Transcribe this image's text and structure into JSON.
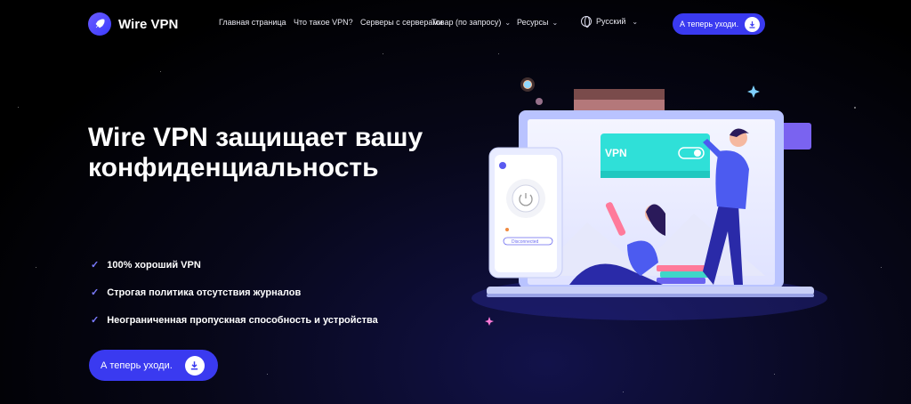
{
  "brand": {
    "name": "Wire VPN"
  },
  "nav": {
    "items": [
      {
        "label": "Главная страница",
        "has_dropdown": false
      },
      {
        "label": "Что такое VPN?",
        "has_dropdown": false
      },
      {
        "label": "Серверы с серверами",
        "has_dropdown": false
      },
      {
        "label": "Товар (по запросу)",
        "has_dropdown": true
      },
      {
        "label": "Ресурсы",
        "has_dropdown": true
      }
    ],
    "language": "Русский",
    "cta_label": "А теперь уходи."
  },
  "hero": {
    "title": "Wire VPN защищает вашу конфиденциальность",
    "features": [
      "100% хороший VPN",
      "Строгая политика отсутствия журналов",
      "Неограниченная пропускная способность и устройства"
    ],
    "cta_label": "А теперь уходи."
  },
  "illustration": {
    "toggle_label": "VPN",
    "phone_status": "Disconnected"
  },
  "colors": {
    "accent": "#3a3af0",
    "check": "#7b7bff",
    "teal": "#2fe0d8"
  },
  "icons": {
    "download": "download-icon",
    "globe": "globe-icon",
    "check": "check-icon",
    "logo": "rocket-logo-icon"
  }
}
